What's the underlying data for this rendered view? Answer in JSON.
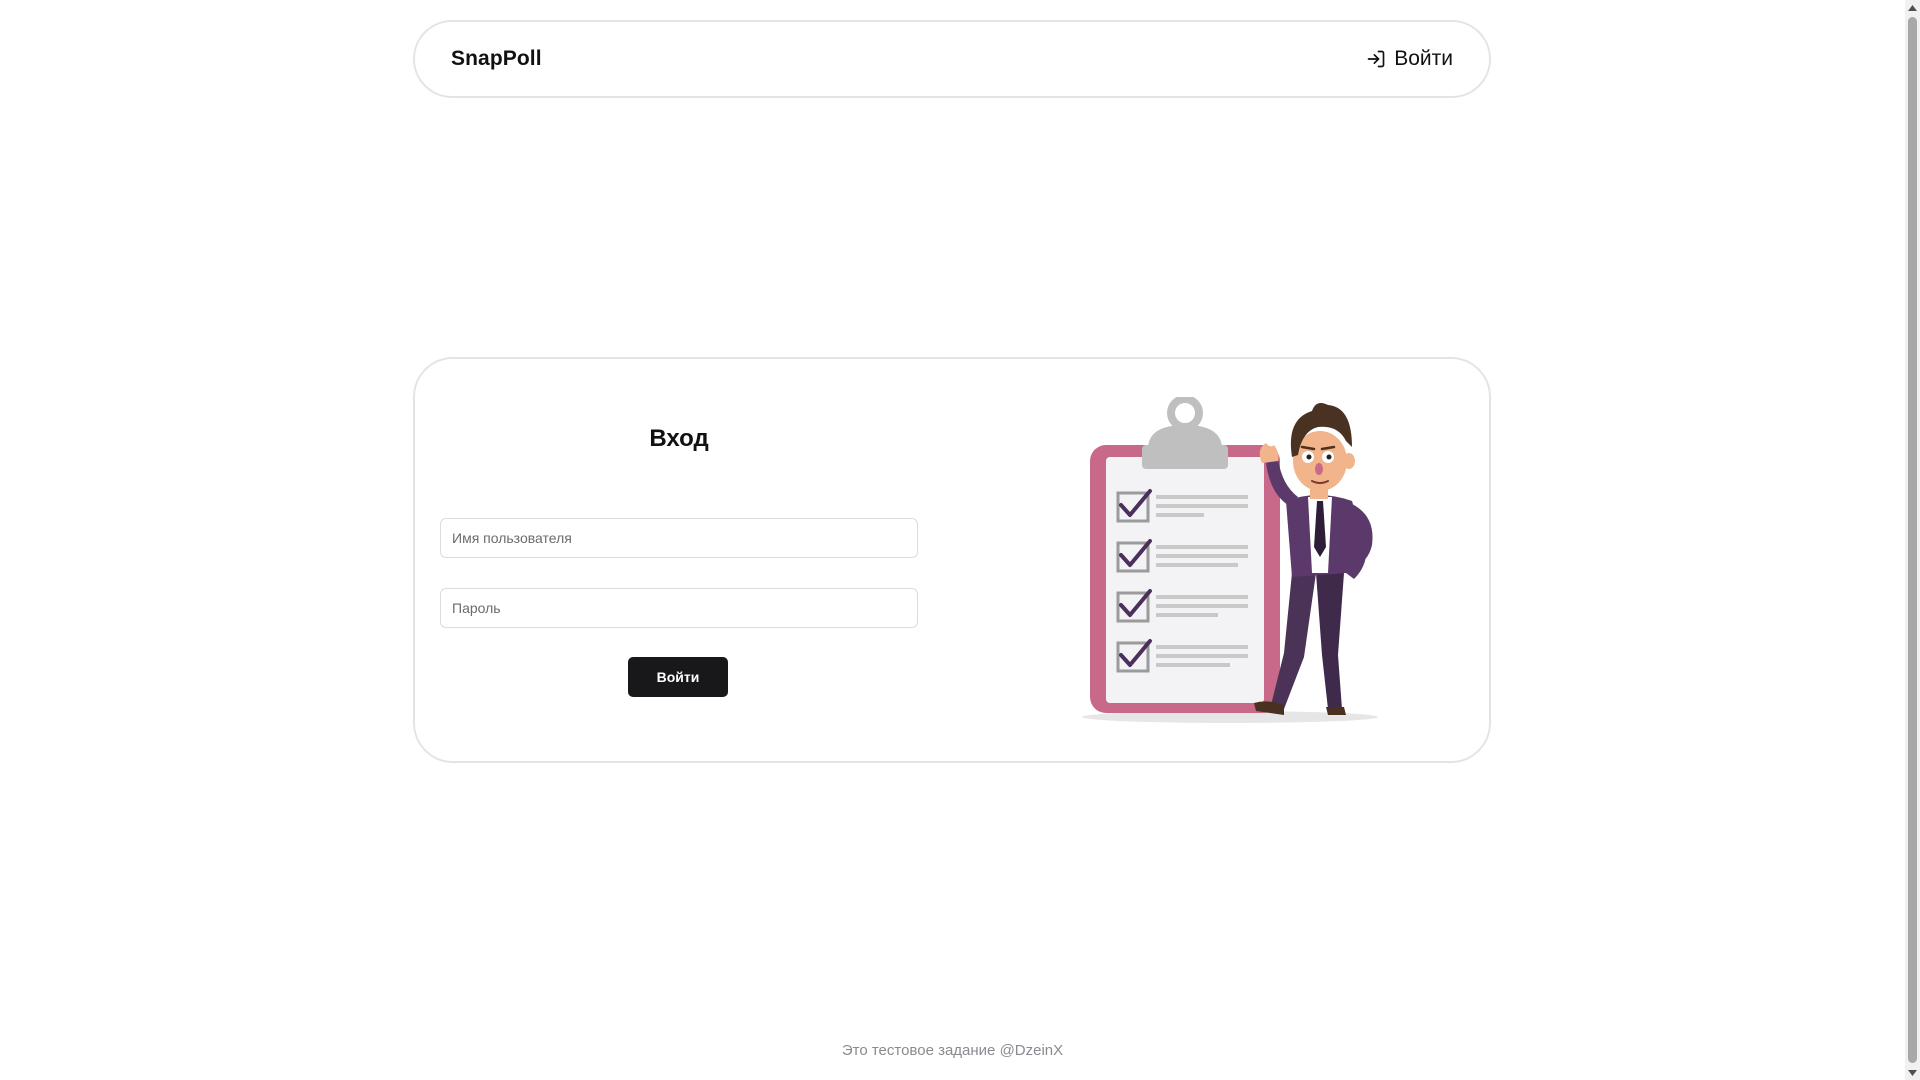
{
  "header": {
    "brand": "SnapPoll",
    "login_label": "Войти",
    "login_icon": "log-in-icon"
  },
  "login_form": {
    "title": "Вход",
    "username_placeholder": "Имя пользователя",
    "username_value": "",
    "password_placeholder": "Пароль",
    "password_value": "",
    "submit_label": "Войти"
  },
  "illustration": {
    "icon": "clipboard-checklist-businessman-illustration",
    "checked_items": 4
  },
  "footer": {
    "text": "Это тестовое задание @DzeinX"
  },
  "colors": {
    "accent": "#18181b",
    "border": "#e4e4e7",
    "footer_text": "#8a8a90",
    "clipboard": "#c8698a",
    "suit": "#5b3a6b"
  }
}
